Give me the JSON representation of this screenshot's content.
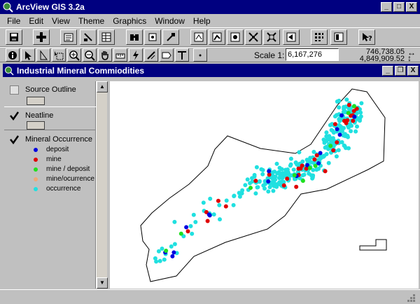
{
  "app": {
    "title": "ArcView GIS 3.2a",
    "window_controls": {
      "minimize": "_",
      "maximize": "□",
      "close": "X"
    }
  },
  "menu": [
    "File",
    "Edit",
    "View",
    "Theme",
    "Graphics",
    "Window",
    "Help"
  ],
  "toolbar1": {
    "buttons": [
      "save-icon",
      "add-theme-icon",
      "theme-properties-icon",
      "edit-legend-icon",
      "open-theme-table-icon",
      "find-icon",
      "locate-address-icon",
      "query-builder-icon",
      "zoom-full-extent-icon",
      "zoom-active-themes-icon",
      "zoom-selected-icon",
      "zoom-in-icon",
      "zoom-out-icon",
      "zoom-previous-icon",
      "select-features-icon",
      "clear-selection-icon",
      "help-icon"
    ]
  },
  "toolbar2": {
    "tools": [
      "identify-icon",
      "pointer-icon",
      "vertex-edit-icon",
      "select-feature-icon",
      "zoom-in-tool-icon",
      "zoom-out-tool-icon",
      "pan-icon",
      "measure-icon",
      "hotlink-icon",
      "area-of-interest-icon",
      "label-icon",
      "text-icon",
      "draw-point-icon"
    ],
    "scale_label": "Scale 1:",
    "scale_value": "6,167,276",
    "coord_x": "746,738.05",
    "coord_y": "4,849,909.52",
    "coord_arrows": "↔\n↕"
  },
  "view": {
    "title": "Industrial Mineral Commiodities",
    "controls": {
      "minimize": "_",
      "restore": "❐",
      "close": "X"
    }
  },
  "legend": {
    "themes": [
      {
        "name": "Source Outline",
        "visible": false
      },
      {
        "name": "Neatline",
        "visible": true
      },
      {
        "name": "Mineral Occurrence",
        "visible": true
      }
    ],
    "classes": [
      {
        "label": "deposit",
        "color": "#0000e0"
      },
      {
        "label": "mine",
        "color": "#e00000"
      },
      {
        "label": "mine / deposit",
        "color": "#20e020"
      },
      {
        "label": "mine/ocurrence",
        "color": "#f0a878"
      },
      {
        "label": "occurrence",
        "color": "#20e0e0"
      }
    ],
    "scroll_up": "▲",
    "scroll_down": "▼"
  },
  "colors": {
    "titlebar": "#000080",
    "chrome": "#c0c0c0",
    "deposit": "#0000e0",
    "mine": "#e00000",
    "mine_deposit": "#20e020",
    "mine_occurrence": "#f0a878",
    "occurrence": "#20e0e0"
  },
  "map": {
    "clusters": [
      {
        "theme": "occurrence",
        "count": 330
      },
      {
        "theme": "mine",
        "count": 30
      },
      {
        "theme": "deposit",
        "count": 16
      },
      {
        "theme": "mine / deposit",
        "count": 10
      }
    ]
  }
}
